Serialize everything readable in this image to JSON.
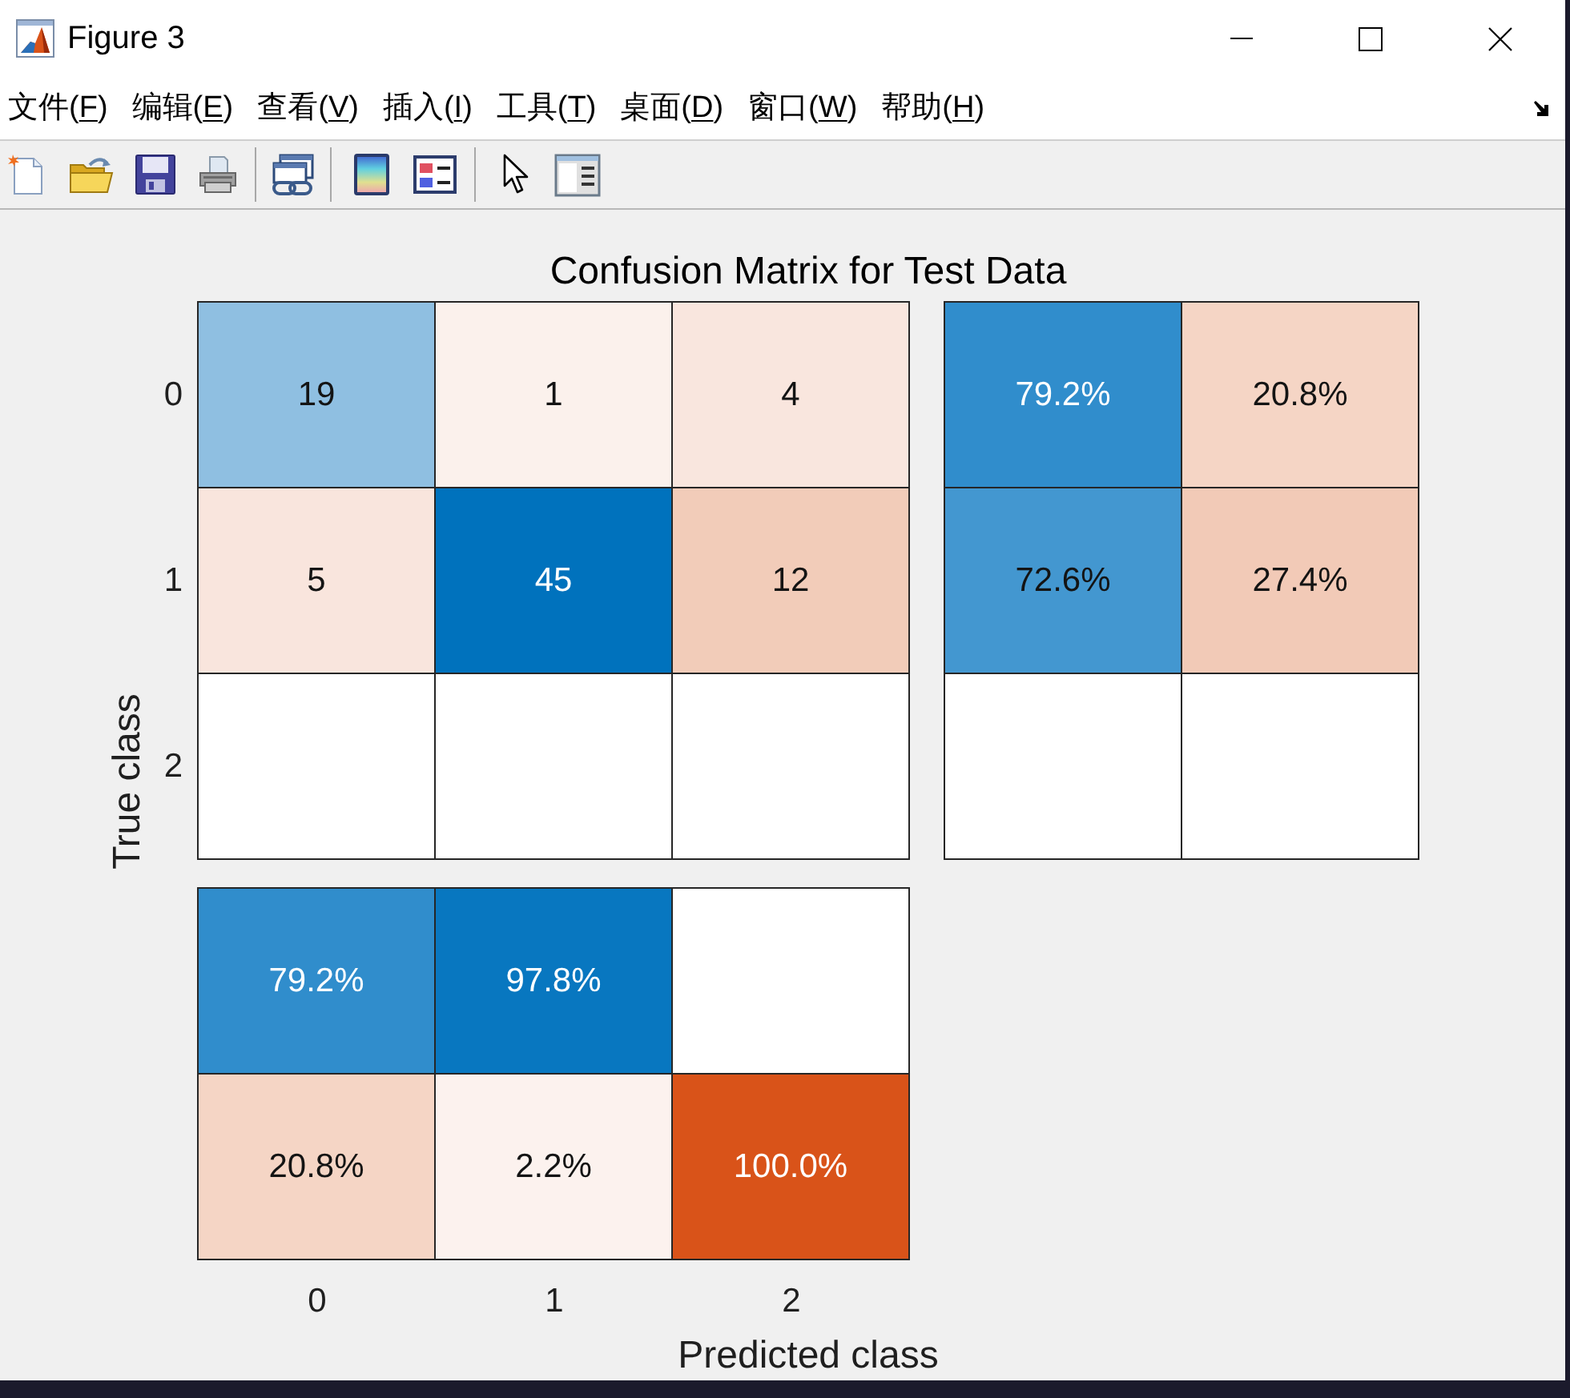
{
  "window": {
    "title": "Figure 3"
  },
  "menu_bar": [
    {
      "text": "文件(",
      "key": "F",
      "end": ")"
    },
    {
      "text": "编辑(",
      "key": "E",
      "end": ")"
    },
    {
      "text": "查看(",
      "key": "V",
      "end": ")"
    },
    {
      "text": "插入(",
      "key": "I",
      "end": ")"
    },
    {
      "text": "工具(",
      "key": "T",
      "end": ")"
    },
    {
      "text": "桌面(",
      "key": "D",
      "end": ")"
    },
    {
      "text": "窗口(",
      "key": "W",
      "end": ")"
    },
    {
      "text": "帮助(",
      "key": "H",
      "end": ")"
    }
  ],
  "figure": {
    "title": "Confusion Matrix for Test Data",
    "ylabel": "True class",
    "xlabel": "Predicted class",
    "row_labels": [
      "0",
      "1",
      "2"
    ],
    "column_labels": [
      "0",
      "1",
      "2"
    ],
    "matrix": [
      [
        {
          "value": "19",
          "color": "#8fbfe1"
        },
        {
          "value": "1",
          "color": "#fbf1ec"
        },
        {
          "value": "4",
          "color": "#f9e6de"
        }
      ],
      [
        {
          "value": "5",
          "color": "#f9e5dd"
        },
        {
          "value": "45",
          "color": "#0072bd"
        },
        {
          "value": "12",
          "color": "#f2ccb9"
        }
      ],
      [
        {
          "color": "#ffffff"
        },
        {
          "color": "#ffffff"
        },
        {
          "color": "#ffffff"
        }
      ]
    ],
    "row_summary": [
      [
        {
          "value": "79.2%",
          "color": "#308dcc"
        },
        {
          "value": "20.8%",
          "color": "#f5d5c5"
        }
      ],
      [
        {
          "value": "72.6%",
          "color": "#4397d0"
        },
        {
          "value": "27.4%",
          "color": "#f2cab7"
        }
      ],
      [
        {
          "color": "#ffffff"
        },
        {
          "color": "#ffffff"
        }
      ]
    ],
    "column_summary": [
      [
        {
          "value": "79.2%",
          "color": "#308dcc"
        },
        {
          "value": "97.8%",
          "color": "#0877c0"
        },
        {
          "color": "#ffffff"
        }
      ],
      [
        {
          "value": "20.8%",
          "color": "#f5d5c5"
        },
        {
          "value": "2.2%",
          "color": "#fcf2ee"
        },
        {
          "value": "100.0%",
          "color": "#d95319"
        }
      ]
    ]
  }
}
